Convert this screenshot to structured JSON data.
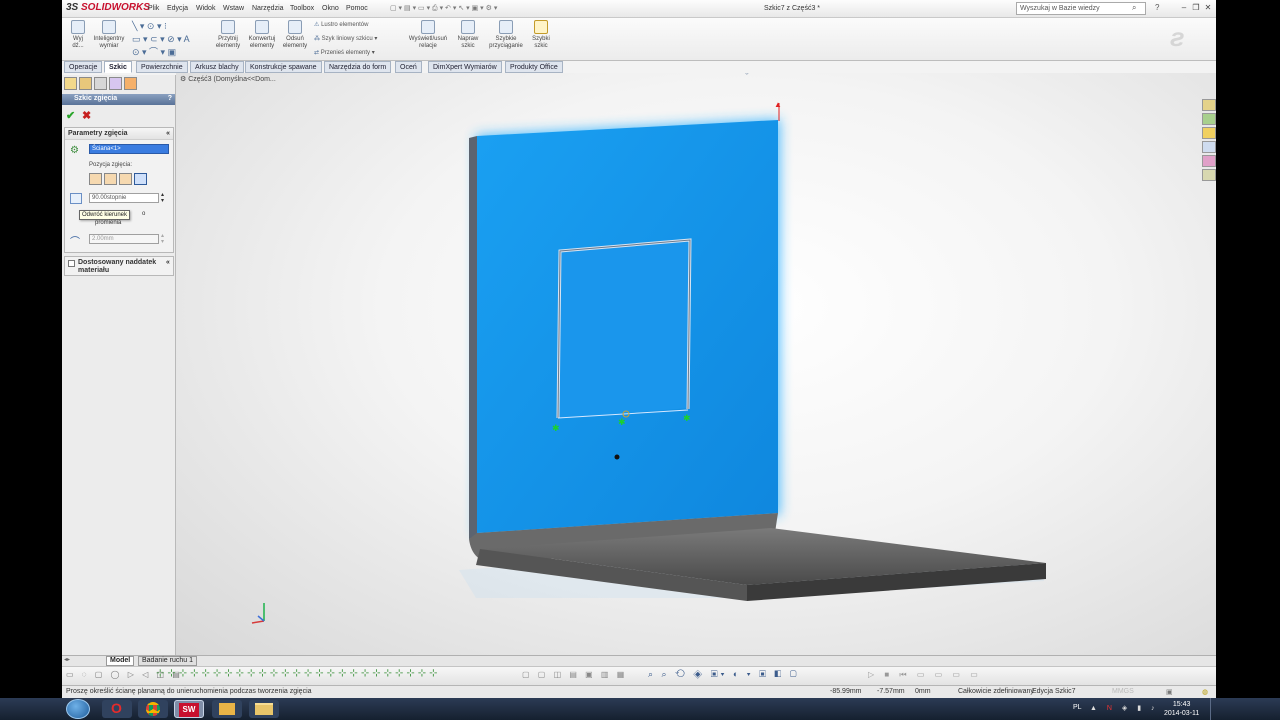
{
  "app": {
    "brand_prefix": "3S",
    "brand_name": "SOLIDWORKS",
    "doc_title": "Szkic7 z Część3 *"
  },
  "menu": [
    "Plik",
    "Edycja",
    "Widok",
    "Wstaw",
    "Narzędzia",
    "Toolbox",
    "Okno",
    "Pomoc"
  ],
  "search": {
    "placeholder": "Wyszukaj w Bazie wiedzy"
  },
  "ribbon": {
    "exit": "Wyj dź...",
    "smart_dim": "Inteligentny wymiar",
    "trim": "Przytnij elementy",
    "convert": "Konwertuj elementy",
    "offset": "Odsuń elementy",
    "mirror": "Lustro elementów",
    "linear_pattern": "Szyk liniowy szkicu",
    "move": "Przenieś elementy",
    "relations": "Wyświetl/usuń relacje",
    "repair": "Napraw szkic",
    "snaps": "Szybkie przyciąganie",
    "rapid_sketch": "Szybki szkic"
  },
  "tabs": [
    "Operacje",
    "Szkic",
    "Powierzchnie",
    "Arkusz blachy",
    "Konstrukcje spawane",
    "Narzędzia do form",
    "Oceń",
    "DimXpert Wymiarów",
    "Produkty Office"
  ],
  "active_tab": "Szkic",
  "breadcrumb": "Część3  (Domyślna<<Dom...",
  "property_manager": {
    "title": "Szkic zgięcia",
    "help": "?",
    "group_params": "Parametry zgięcia",
    "face_value": "Ściana<1>",
    "position_label": "Pozycja zgięcia:",
    "angle_value": "90.00stopnie",
    "tooltip": "Odwróć kierunek",
    "partial_text": "o",
    "partial_text2": "promienia",
    "radius_value": "2.00mm",
    "group_custom": "Dostosowany naddatek materiału"
  },
  "bottom_tabs": [
    "Model",
    "Badanie ruchu 1"
  ],
  "status": {
    "message": "Proszę określić ścianę planarną do unieruchomienia podczas tworzenia zgięcia",
    "x": "-85.99mm",
    "y": "-7.57mm",
    "z": "0mm",
    "state": "Całkowicie zdefiniowany",
    "editing": "Edycja Szkic7",
    "units": "MMGS"
  },
  "taskbar": {
    "lang": "PL",
    "time": "15:43",
    "date": "2014-03-11"
  },
  "colors": {
    "face_blue": "#1ea0f0",
    "accent_red": "#c8102e",
    "pm_header": "#6a83a8"
  }
}
